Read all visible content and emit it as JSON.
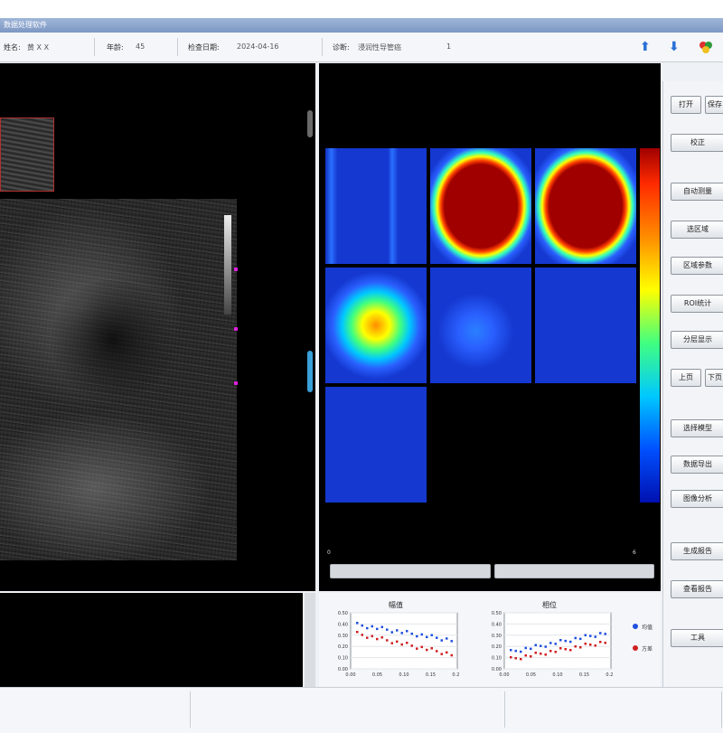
{
  "window": {
    "title": "数据处理软件"
  },
  "toolbar": {
    "fields": [
      {
        "label": "姓名:",
        "value": "黄 X X"
      },
      {
        "label": "年龄:",
        "value": "45"
      },
      {
        "label": "检查日期:",
        "value": "2024-04-16"
      },
      {
        "label": "诊断:",
        "value": "浸润性导管癌",
        "extra": "1"
      }
    ]
  },
  "heatmap": {
    "tiles": [
      {
        "row": 0,
        "col": 0,
        "pattern": "edges"
      },
      {
        "row": 0,
        "col": 1,
        "pattern": "square-hot"
      },
      {
        "row": 0,
        "col": 2,
        "pattern": "square-hot"
      },
      {
        "row": 1,
        "col": 0,
        "pattern": "blob-hot"
      },
      {
        "row": 1,
        "col": 1,
        "pattern": "blob-weak"
      },
      {
        "row": 1,
        "col": 2,
        "pattern": "flat"
      },
      {
        "row": 2,
        "col": 0,
        "pattern": "flat"
      }
    ],
    "scroll_left_label": "0",
    "scroll_right_label": "6"
  },
  "charts": [
    {
      "title": "幅值",
      "x_ticks": [
        "0.00",
        "0.05",
        "0.10",
        "0.15",
        "0.20"
      ],
      "y_ticks": [
        "0.50",
        "0.40",
        "0.30",
        "0.20",
        "0.10",
        "0.00"
      ]
    },
    {
      "title": "相位",
      "x_ticks": [
        "0.00",
        "0.05",
        "0.10",
        "0.15",
        "0.20"
      ],
      "y_ticks": [
        "0.50",
        "0.40",
        "0.30",
        "0.20",
        "0.10",
        "0.00"
      ]
    }
  ],
  "legend": [
    {
      "label": "均值",
      "color": "#2050e0"
    },
    {
      "label": "方差",
      "color": "#d02020"
    }
  ],
  "buttons": [
    {
      "id": "open",
      "label": "打开"
    },
    {
      "id": "save",
      "label": "保存"
    },
    {
      "id": "calibrate",
      "label": "校正"
    },
    {
      "id": "auto-measure",
      "label": "自动测量"
    },
    {
      "id": "roi",
      "label": "选区域"
    },
    {
      "id": "region-params",
      "label": "区域参数"
    },
    {
      "id": "roi-stats",
      "label": "ROI统计"
    },
    {
      "id": "layer-display",
      "label": "分层显示"
    },
    {
      "id": "prev",
      "label": "上页"
    },
    {
      "id": "next",
      "label": "下页"
    },
    {
      "id": "select-model",
      "label": "选择模型"
    },
    {
      "id": "data-export",
      "label": "数据导出"
    },
    {
      "id": "image-analysis",
      "label": "图像分析"
    },
    {
      "id": "generate-report",
      "label": "生成报告"
    },
    {
      "id": "view-report",
      "label": "查看报告"
    },
    {
      "id": "tools",
      "label": "工具"
    }
  ],
  "colors": {
    "heat_low": "#1538d0",
    "heat_high": "#a00000",
    "accent_arrow": "#2a6fd6"
  }
}
